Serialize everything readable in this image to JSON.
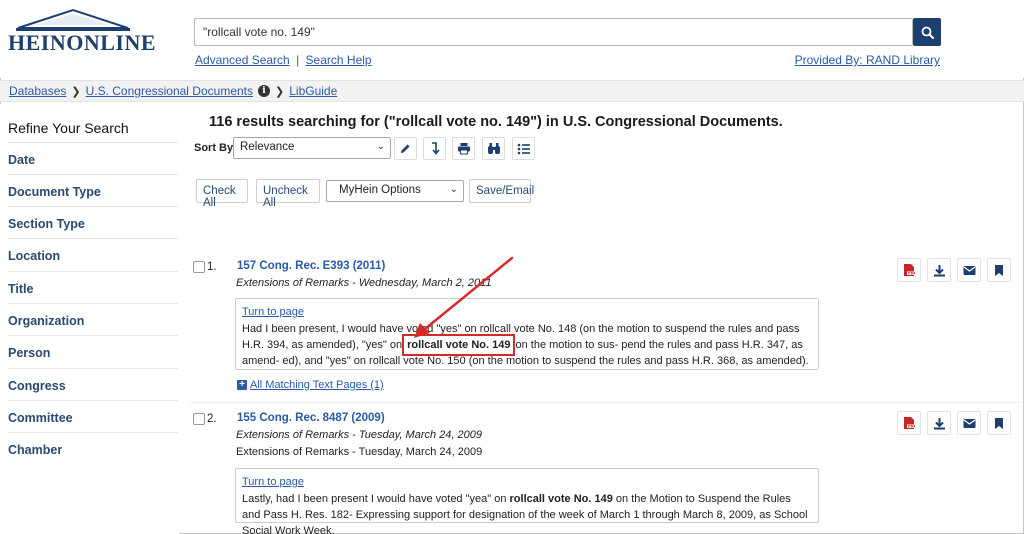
{
  "header": {
    "logo_text": "HEINONLINE",
    "search_value": "\"rollcall vote no. 149\"",
    "advanced_search": "Advanced Search",
    "separator": "|",
    "search_help": "Search Help",
    "provided_by": "Provided By: RAND Library"
  },
  "breadcrumb": {
    "databases": "Databases",
    "collection": "U.S. Congressional Documents",
    "info": "i",
    "libguide": "LibGuide"
  },
  "sidebar": {
    "title": "Refine Your Search",
    "facets": [
      "Date",
      "Document Type",
      "Section Type",
      "Location",
      "Title",
      "Organization",
      "Person",
      "Congress",
      "Committee",
      "Chamber"
    ]
  },
  "main": {
    "results_title": "116 results searching for (\"rollcall vote no. 149\") in U.S. Congressional Documents.",
    "sort_label": "Sort By:",
    "sort_value": "Relevance",
    "check_all": "Check All",
    "uncheck_all": "Uncheck All",
    "myhein_options": "MyHein Options",
    "save_email": "Save/Email"
  },
  "results": [
    {
      "number": "1.",
      "title": "157 Cong. Rec. E393 (2011)",
      "subtitle": "Extensions of Remarks - Wednesday, March 2, 2011",
      "turn_to_page": "Turn to page",
      "snippet_pre": "Had I been present, I would have voted \"yes\" on rollcall vote No. 148 (on the motion to suspend the rules and pass H.R. 394, as amended), \"yes\" on ",
      "snippet_hl": "rollcall vote No. 149",
      "snippet_post": " on the motion to sus- pend the rules and pass H.R. 347, as amend- ed), and \"yes\" on rollcall vote No. 150 (on the motion to suspend the rules and pass H.R. 368, as amended).",
      "matching": "All Matching Text Pages (1)"
    },
    {
      "number": "2.",
      "title": "155 Cong. Rec. 8487 (2009)",
      "subtitle": "Extensions of Remarks - Tuesday, March 24, 2009",
      "subtitle2": "Extensions of Remarks - Tuesday, March 24, 2009",
      "turn_to_page": "Turn to page",
      "snippet_pre": "Lastly, had I been present I would have voted \"yea\" on ",
      "snippet_hl": "rollcall vote No. 149",
      "snippet_post": " on the Motion to Suspend the Rules and Pass H. Res. 182- Expressing support for designation of the week of March 1 through March 8, 2009, as School Social Work Week."
    }
  ],
  "colors": {
    "brand_navy": "#1c3f6e",
    "link_blue": "#2a5aa8",
    "highlight_red": "#d42a2a",
    "pdf_red": "#c62828"
  }
}
